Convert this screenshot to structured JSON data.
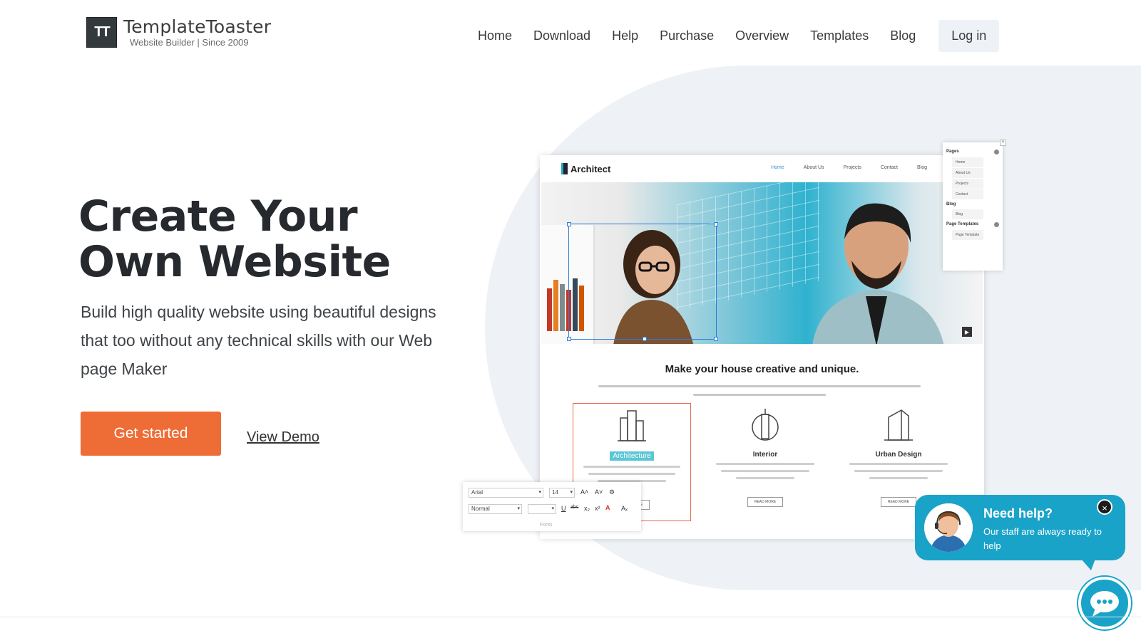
{
  "header": {
    "logo_mark": "TT",
    "logo_name": "TemplateToaster",
    "logo_tagline": "Website Builder | Since 2009",
    "nav": [
      "Home",
      "Download",
      "Help",
      "Purchase",
      "Overview",
      "Templates",
      "Blog"
    ],
    "login_label": "Log in"
  },
  "hero": {
    "title": "Create Your Own Website",
    "subtitle": "Build high quality website using beautiful designs that too without any technical skills with our Web page Maker",
    "cta_label": "Get started",
    "demo_label": "View Demo"
  },
  "mock_site": {
    "brand": "Architect",
    "nav": [
      "Home",
      "About Us",
      "Projects",
      "Contact",
      "Blog"
    ],
    "headline": "Make your house creative and unique.",
    "features": [
      {
        "title": "Architecture",
        "button": "READ MORE"
      },
      {
        "title": "Interior",
        "button": "READ MORE"
      },
      {
        "title": "Urban Design",
        "button": "READ MORE"
      }
    ]
  },
  "pages_panel": {
    "pages_label": "Pages",
    "pages": [
      "Home",
      "About Us",
      "Projects",
      "Contact"
    ],
    "blog_label": "Blog",
    "blog_items": [
      "Blog"
    ],
    "templates_label": "Page Templates",
    "template_items": [
      "Page Template"
    ]
  },
  "font_toolbar": {
    "font_family": "Arial",
    "font_size": "14",
    "style": "Normal",
    "label": "Fonts"
  },
  "chat": {
    "title": "Need help?",
    "text": "Our staff are always ready to help",
    "close_label": "×"
  },
  "colors": {
    "accent": "#ee6c35",
    "chat": "#1aa3c9",
    "dark": "#262a2e"
  }
}
